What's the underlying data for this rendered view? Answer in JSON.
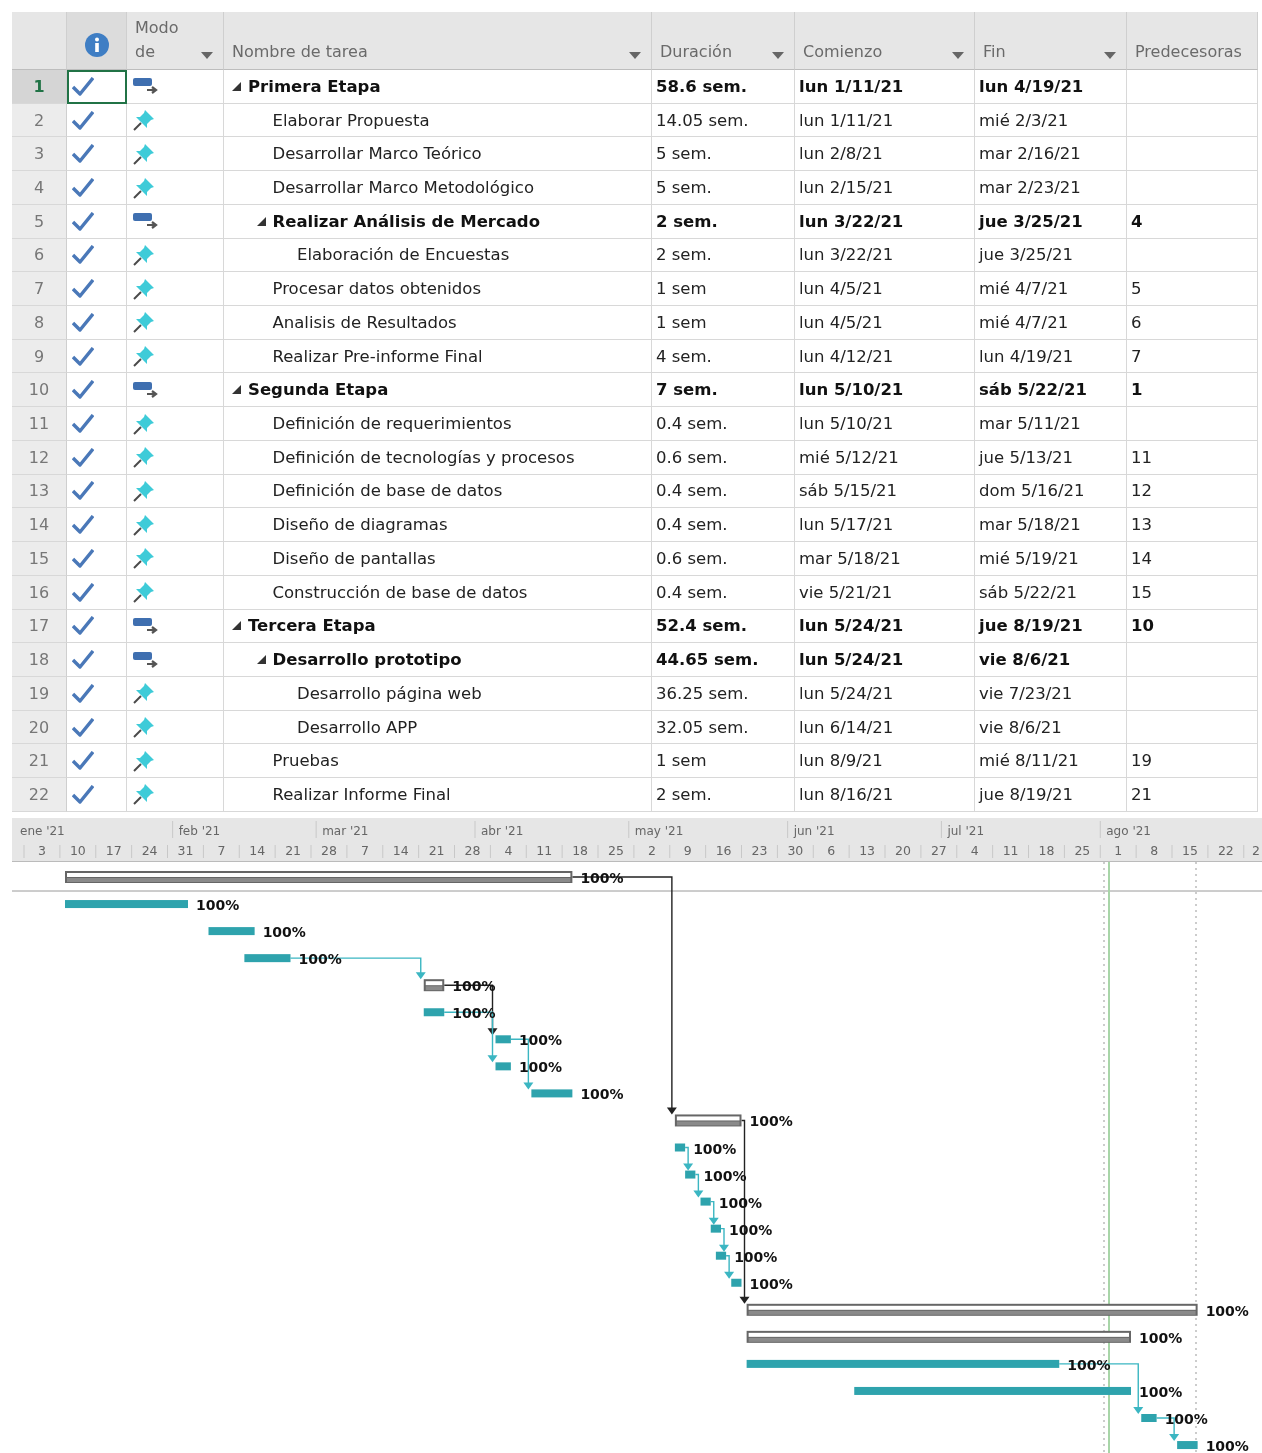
{
  "columns": [
    {
      "kind": "indicator"
    },
    {
      "kind": "mode",
      "label": "Modo de",
      "dropdown": true
    },
    {
      "kind": "name",
      "label": "Nombre de tarea",
      "dropdown": true
    },
    {
      "kind": "duration",
      "label": "Duración",
      "dropdown": true
    },
    {
      "kind": "start",
      "label": "Comienzo",
      "dropdown": true
    },
    {
      "kind": "end",
      "label": "Fin",
      "dropdown": true
    },
    {
      "kind": "predecessors",
      "label": "Predecesoras",
      "dropdown": false
    }
  ],
  "tasks": [
    {
      "id": "1",
      "name": "Primera Etapa",
      "kind": "summary",
      "complete": true,
      "selected": true,
      "expanded": true,
      "duration": "58.6 sem.",
      "start": "lun 1/11/21",
      "end": "lun 4/19/21",
      "progress": "100%",
      "children": [
        {
          "id": "2",
          "name": "Elaborar Propuesta",
          "kind": "task",
          "complete": true,
          "selected": false,
          "duration": "14.05 sem.",
          "start": "lun 1/11/21",
          "end": "mié 2/3/21",
          "progress": "100%"
        },
        {
          "id": "3",
          "name": "Desarrollar Marco Teórico",
          "kind": "task",
          "complete": true,
          "selected": false,
          "duration": "5 sem.",
          "start": "lun 2/8/21",
          "end": "mar 2/16/21",
          "progress": "100%"
        },
        {
          "id": "4",
          "name": "Desarrollar Marco Metodológico",
          "kind": "task",
          "complete": true,
          "selected": false,
          "duration": "5 sem.",
          "start": "lun 2/15/21",
          "end": "mar 2/23/21",
          "progress": "100%"
        },
        {
          "id": "5",
          "name": "Realizar Análisis de Mercado",
          "kind": "summary",
          "complete": true,
          "selected": false,
          "expanded": true,
          "duration": "2 sem.",
          "start": "lun 3/22/21",
          "end": "jue 3/25/21",
          "predecessors": "4",
          "progress": "100%",
          "children": [
            {
              "id": "6",
              "name": "Elaboración de Encuestas",
              "kind": "task",
              "complete": true,
              "selected": false,
              "duration": "2 sem.",
              "start": "lun 3/22/21",
              "end": "jue 3/25/21",
              "progress": "100%"
            }
          ]
        },
        {
          "id": "7",
          "name": "Procesar datos obtenidos",
          "kind": "task",
          "complete": true,
          "selected": false,
          "duration": "1 sem",
          "start": "lun 4/5/21",
          "end": "mié 4/7/21",
          "predecessors": "5",
          "progress": "100%"
        },
        {
          "id": "8",
          "name": "Analisis de Resultados",
          "kind": "task",
          "complete": true,
          "selected": false,
          "duration": "1 sem",
          "start": "lun 4/5/21",
          "end": "mié 4/7/21",
          "predecessors": "6",
          "progress": "100%"
        },
        {
          "id": "9",
          "name": "Realizar Pre-informe Final",
          "kind": "task",
          "complete": true,
          "selected": false,
          "duration": "4 sem.",
          "start": "lun 4/12/21",
          "end": "lun 4/19/21",
          "predecessors": "7",
          "progress": "100%"
        }
      ]
    },
    {
      "id": "10",
      "name": "Segunda Etapa",
      "kind": "summary",
      "complete": true,
      "selected": false,
      "expanded": true,
      "duration": "7 sem.",
      "start": "lun 5/10/21",
      "end": "sáb 5/22/21",
      "predecessors": "1",
      "progress": "100%",
      "children": [
        {
          "id": "11",
          "name": "Definición de requerimientos",
          "kind": "task",
          "complete": true,
          "selected": false,
          "duration": "0.4 sem.",
          "start": "lun 5/10/21",
          "end": "mar 5/11/21",
          "progress": "100%"
        },
        {
          "id": "12",
          "name": "Definición de tecnologías y procesos",
          "kind": "task",
          "complete": true,
          "selected": false,
          "duration": "0.6 sem.",
          "start": "mié 5/12/21",
          "end": "jue 5/13/21",
          "predecessors": "11",
          "progress": "100%"
        },
        {
          "id": "13",
          "name": "Definición de base de datos",
          "kind": "task",
          "complete": true,
          "selected": false,
          "duration": "0.4 sem.",
          "start": "sáb 5/15/21",
          "end": "dom 5/16/21",
          "predecessors": "12",
          "progress": "100%"
        },
        {
          "id": "14",
          "name": "Diseño de diagramas",
          "kind": "task",
          "complete": true,
          "selected": false,
          "duration": "0.4 sem.",
          "start": "lun 5/17/21",
          "end": "mar 5/18/21",
          "predecessors": "13",
          "progress": "100%"
        },
        {
          "id": "15",
          "name": "Diseño de pantallas",
          "kind": "task",
          "complete": true,
          "selected": false,
          "duration": "0.6 sem.",
          "start": "mar 5/18/21",
          "end": "mié 5/19/21",
          "predecessors": "14",
          "progress": "100%"
        },
        {
          "id": "16",
          "name": "Construcción de base de datos",
          "kind": "task",
          "complete": true,
          "selected": false,
          "duration": "0.4 sem.",
          "start": "vie 5/21/21",
          "end": "sáb 5/22/21",
          "predecessors": "15",
          "progress": "100%"
        }
      ]
    },
    {
      "id": "17",
      "name": "Tercera Etapa",
      "kind": "summary",
      "complete": true,
      "selected": false,
      "expanded": true,
      "duration": "52.4 sem.",
      "start": "lun 5/24/21",
      "end": "jue 8/19/21",
      "predecessors": "10",
      "progress": "100%",
      "children": [
        {
          "id": "18",
          "name": "Desarrollo prototipo",
          "kind": "summary",
          "complete": true,
          "selected": false,
          "expanded": true,
          "duration": "44.65 sem.",
          "start": "lun 5/24/21",
          "end": "vie 8/6/21",
          "progress": "100%",
          "children": [
            {
              "id": "19",
              "name": "Desarrollo página web",
              "kind": "task",
              "complete": true,
              "selected": false,
              "duration": "36.25 sem.",
              "start": "lun 5/24/21",
              "end": "vie 7/23/21",
              "progress": "100%"
            },
            {
              "id": "20",
              "name": "Desarrollo APP",
              "kind": "task",
              "complete": true,
              "selected": false,
              "duration": "32.05 sem.",
              "start": "lun 6/14/21",
              "end": "vie 8/6/21",
              "progress": "100%"
            }
          ]
        },
        {
          "id": "21",
          "name": "Pruebas",
          "kind": "task",
          "complete": true,
          "selected": false,
          "duration": "1 sem",
          "start": "lun 8/9/21",
          "end": "mié 8/11/21",
          "predecessors": "19",
          "progress": "100%"
        },
        {
          "id": "22",
          "name": "Realizar Informe Final",
          "kind": "task",
          "complete": true,
          "selected": false,
          "duration": "2 sem.",
          "start": "lun 8/16/21",
          "end": "jue 8/19/21",
          "predecessors": "21",
          "progress": "100%"
        }
      ]
    }
  ],
  "timescale": {
    "months": [
      "ene '21",
      "feb '21",
      "mar '21",
      "abr '21",
      "may '21",
      "jun '21",
      "jul '21",
      "ago '21"
    ],
    "weeks": [
      "3",
      "10",
      "17",
      "24",
      "31",
      "7",
      "14",
      "21",
      "28",
      "7",
      "14",
      "21",
      "28",
      "4",
      "11",
      "18",
      "25",
      "2",
      "9",
      "16",
      "23",
      "30",
      "6",
      "13",
      "20",
      "27",
      "4",
      "11",
      "18",
      "25",
      "1",
      "8",
      "15",
      "22",
      "2"
    ]
  }
}
